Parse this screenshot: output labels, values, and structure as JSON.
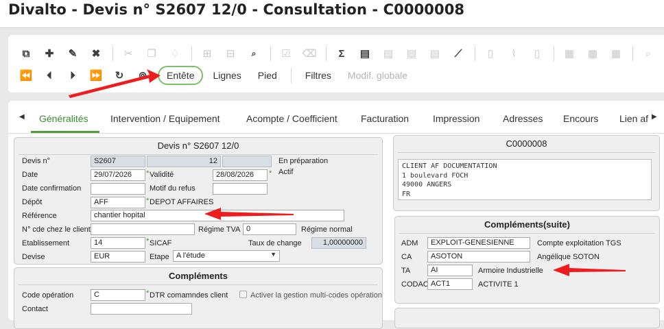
{
  "window": {
    "title": "Divalto - Devis n° S2607 12/0 - Consultation - C0000008"
  },
  "toolbar": {
    "row1_icons": [
      "copy-icon",
      "plus-icon",
      "pencil-icon",
      "close-icon",
      "scissors-icon",
      "duplicate-icon",
      "paste-icon",
      "add-box-icon",
      "remove-box-icon",
      "search-list-icon",
      "check-icon",
      "eraser-icon",
      "sigma-icon",
      "doc-money-icon",
      "doc-gear-icon",
      "doc-print-icon",
      "doc-send-icon",
      "chart-icon",
      "clipboard-icon",
      "attach-icon",
      "clipboard-list-icon",
      "save-icon",
      "export-icon",
      "import-icon",
      "search-icon"
    ],
    "row2_icons": [
      "first-icon",
      "prev-icon",
      "next-icon",
      "last-icon",
      "refresh-icon",
      "binoculars-icon"
    ],
    "buttons": {
      "entete": "Entête",
      "lignes": "Lignes",
      "pied": "Pied",
      "filtres": "Filtres",
      "modif_globale": "Modif. globale"
    }
  },
  "tabs": [
    "Généralités",
    "Intervention / Equipement",
    "Acompte / Coefficient",
    "Facturation",
    "Impression",
    "Adresses",
    "Encours",
    "Lien af"
  ],
  "devis_panel": {
    "title": "Devis n° S2607 12/0",
    "devis_label": "Devis n°",
    "devis_num": "S2607",
    "devis_idx": "12",
    "status1": "En préparation",
    "status2": "Actif",
    "date_label": "Date",
    "date": "29/07/2026",
    "validite_label": "Validité",
    "validite": "28/08/2026",
    "date_conf_label": "Date confirmation",
    "motif_label": "Motif du refus",
    "depot_label": "Dépôt",
    "depot": "AFF",
    "depot_name": "DEPOT AFFAIRES",
    "reference_label": "Référence",
    "reference": "chantier hopital",
    "ncde_label": "N° cde chez le client",
    "regime_tva_label": "Régime TVA",
    "regime_tva": "0",
    "regime_normal": "Régime normal",
    "etab_label": "Etablissement",
    "etab": "14",
    "etab_name": "SICAF",
    "taux_label": "Taux de change",
    "taux": "1,00000000",
    "devise_label": "Devise",
    "devise": "EUR",
    "etape_label": "Etape",
    "etape": "A l'étude"
  },
  "complements_panel": {
    "title": "Compléments",
    "code_op_label": "Code opération",
    "code_op": "C",
    "code_op_name": "DTR comamndes client",
    "multi_code_label": "Activer la gestion multi-codes opération",
    "contact_label": "Contact"
  },
  "client_panel": {
    "title": "C0000008",
    "address": [
      "CLIENT AF  DOCUMENTATION",
      "1 boulevard FOCH",
      "49000  ANGERS",
      "FR"
    ]
  },
  "complements_suite": {
    "title": "Compléments(suite)",
    "rows": [
      {
        "label": "ADM",
        "value": "EXPLOIT-GENESIENNE",
        "desc": "Compte exploitation TGS"
      },
      {
        "label": "CA",
        "value": "ASOTON",
        "desc": "Angélique SOTON"
      },
      {
        "label": "TA",
        "value": "AI",
        "desc": "Armoire Industrielle"
      },
      {
        "label": "CODAC",
        "value": "ACT1",
        "desc": "ACTIVITE 1"
      }
    ]
  },
  "colors": {
    "accent_green": "#4d9a3a",
    "annotation_red": "#ee1c1c"
  }
}
